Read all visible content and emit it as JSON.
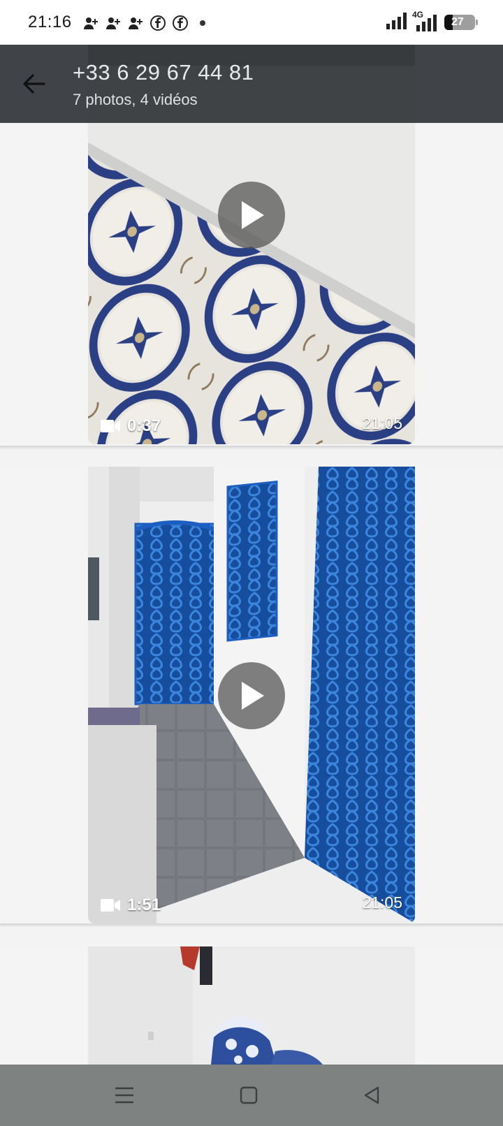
{
  "status_bar": {
    "time": "21:16",
    "network_label": "4G",
    "battery_level": "27",
    "notification_icons": [
      "add-contact-icon",
      "add-contact-icon",
      "add-contact-icon",
      "facebook-icon",
      "facebook-icon",
      "dot-icon"
    ]
  },
  "header": {
    "title": "+33 6 29 67 44 81",
    "subtitle": "7 photos, 4 vidéos"
  },
  "media_items": [
    {
      "type": "video",
      "duration": "0:37",
      "time": "21:05"
    },
    {
      "type": "video",
      "duration": "1:51",
      "time": "21:05"
    },
    {
      "type": "photo"
    }
  ],
  "colors": {
    "appbar": "#303438",
    "tile_blue": "#2a3f86",
    "gate_blue": "#1d5fc1",
    "navbar": "#7e8281"
  }
}
